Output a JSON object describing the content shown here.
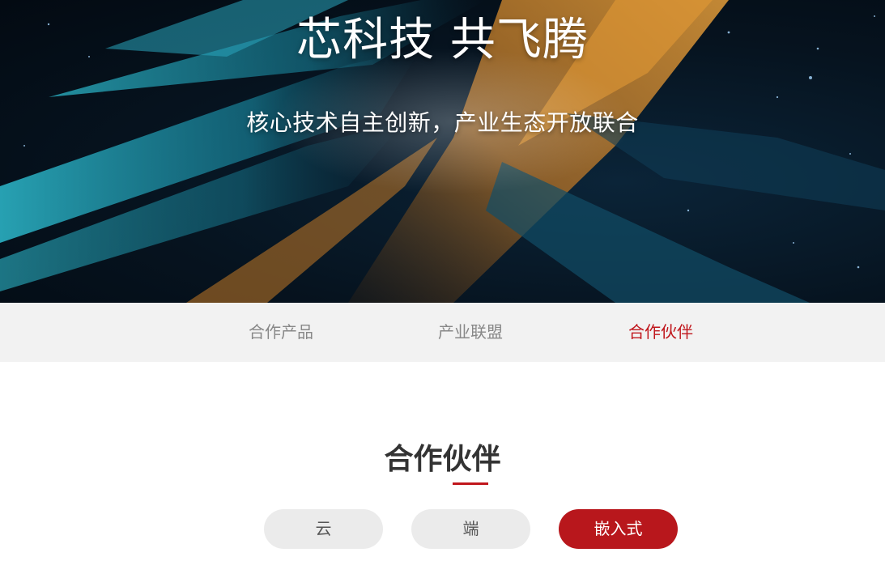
{
  "hero": {
    "title": "芯科技 共飞腾",
    "subtitle": "核心技术自主创新，产业生态开放联合"
  },
  "tabs": [
    {
      "label": "合作产品",
      "active": false
    },
    {
      "label": "产业联盟",
      "active": false
    },
    {
      "label": "合作伙伴",
      "active": true
    }
  ],
  "section": {
    "title": "合作伙伴"
  },
  "filters": [
    {
      "label": "云",
      "active": false
    },
    {
      "label": "端",
      "active": false
    },
    {
      "label": "嵌入式",
      "active": true
    }
  ],
  "colors": {
    "accent": "#c0161c",
    "tabbar_bg": "#f2f2f2",
    "pill_bg": "#ebebeb"
  }
}
